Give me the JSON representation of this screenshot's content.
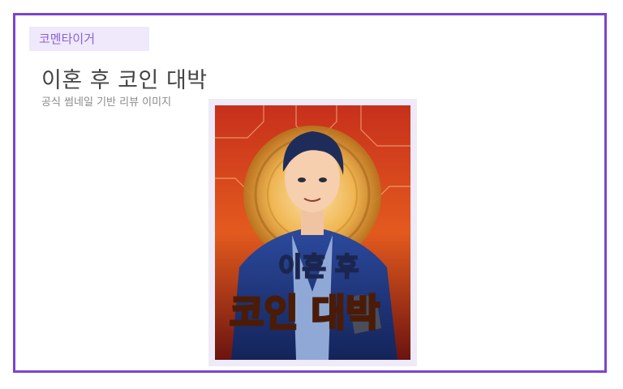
{
  "badge": {
    "label": "코멘타이거"
  },
  "header": {
    "title": "이혼 후 코인 대박",
    "subtitle": "공식 썸네일 기반 리뷰 이미지"
  },
  "cover": {
    "title_line1": "이혼 후",
    "title_line2": "코인 대박",
    "accent_purple": "#7b44d1",
    "badge_bg": "#efe9fb"
  }
}
